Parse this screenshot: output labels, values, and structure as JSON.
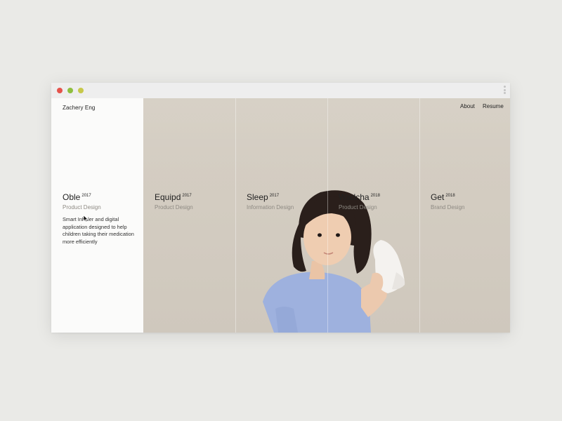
{
  "site": {
    "brand": "Zachery Eng",
    "nav": [
      "About",
      "Resume"
    ]
  },
  "projects": [
    {
      "title": "Oble",
      "year": "2017",
      "category": "Product Design",
      "description": "Smart Inhaler and digital application designed to help children taking their medication more efficiently"
    },
    {
      "title": "Equipd",
      "year": "2017",
      "category": "Product Design"
    },
    {
      "title": "Sleep",
      "year": "2017",
      "category": "Information Design"
    },
    {
      "title": "Wadcha",
      "year": "2018",
      "category": "Product Design"
    },
    {
      "title": "Get",
      "year": "2018",
      "category": "Brand Design"
    }
  ],
  "colors": {
    "window_controls": [
      "#e5534b",
      "#8fbf3f",
      "#c7c84a"
    ],
    "hero_background": "#d3ccc1",
    "page_background": "#eaeae7"
  },
  "hero_image": "photo of a young girl holding a white inhaler device to her ear"
}
